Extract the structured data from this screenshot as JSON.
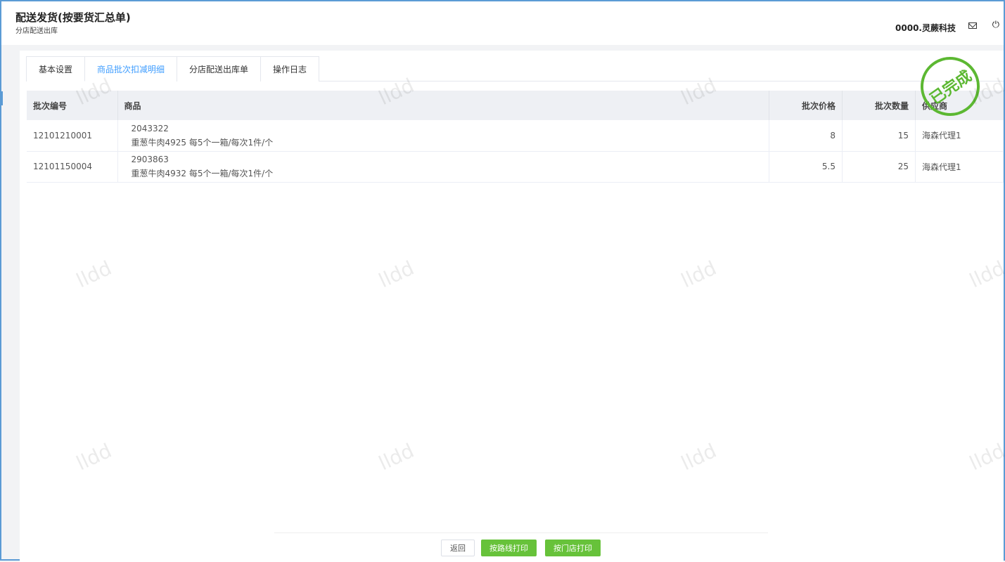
{
  "header": {
    "title": "配送发货(按要货汇总单)",
    "subtitle": "分店配送出库",
    "user": "0000.灵蕨科技"
  },
  "tabs": [
    "基本设置",
    "商品批次扣减明细",
    "分店配送出库单",
    "操作日志"
  ],
  "active_tab": 1,
  "table": {
    "columns": [
      "批次编号",
      "商品",
      "批次价格",
      "批次数量",
      "供应商"
    ],
    "rows": [
      {
        "batch": "12101210001",
        "code": "2043322",
        "name": "重葱牛肉4925 每5个一箱/每次1件/个",
        "price": "8",
        "qty": "15",
        "supplier": "海森代理1"
      },
      {
        "batch": "12101150004",
        "code": "2903863",
        "name": "重葱牛肉4932 每5个一箱/每次1件/个",
        "price": "5.5",
        "qty": "25",
        "supplier": "海森代理1"
      }
    ]
  },
  "stamp": "已完成",
  "watermark": "lldd",
  "buttons": {
    "back": "返回",
    "print_route": "按路线打印",
    "print_store": "按门店打印"
  },
  "colors": {
    "accent": "#409eff",
    "success": "#67c23a",
    "border": "#5b9bd5"
  }
}
